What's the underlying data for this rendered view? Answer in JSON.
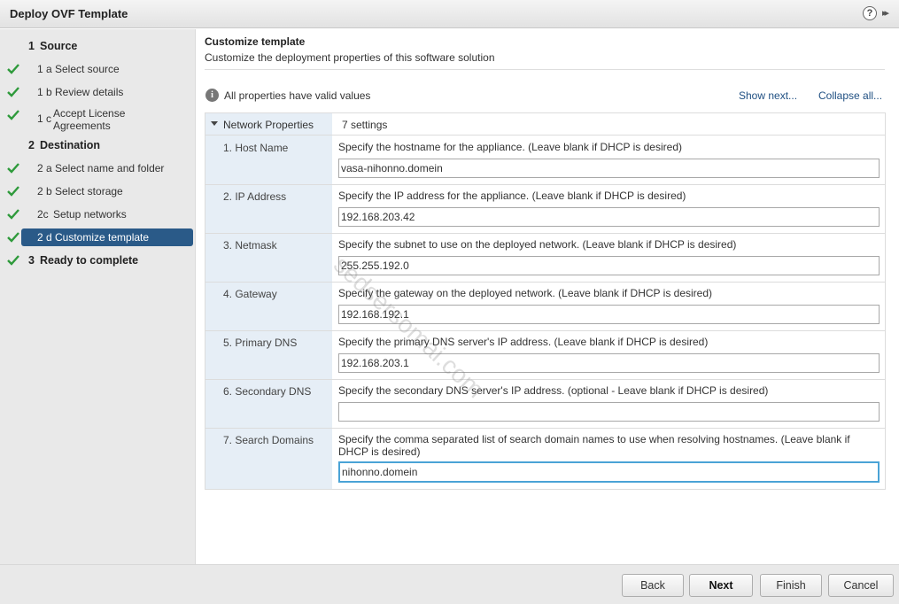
{
  "window": {
    "title": "Deploy OVF Template",
    "help_icon": "?",
    "expand_icon": "▸▸"
  },
  "sidebar": {
    "steps": [
      {
        "num": "1",
        "label": "Source",
        "type": "head",
        "checked": false
      },
      {
        "num": "1 a",
        "label": "Select source",
        "type": "sub",
        "checked": true
      },
      {
        "num": "1 b",
        "label": "Review details",
        "type": "sub",
        "checked": true
      },
      {
        "num": "1 c",
        "label": "Accept License Agreements",
        "type": "sub",
        "checked": true
      },
      {
        "num": "2",
        "label": "Destination",
        "type": "head",
        "checked": false
      },
      {
        "num": "2 a",
        "label": "Select name and folder",
        "type": "sub",
        "checked": true
      },
      {
        "num": "2 b",
        "label": "Select storage",
        "type": "sub",
        "checked": true
      },
      {
        "num": "2c",
        "label": "Setup networks",
        "type": "sub",
        "checked": true
      },
      {
        "num": "2 d",
        "label": "Customize template",
        "type": "sub",
        "checked": true,
        "active": true
      },
      {
        "num": "3",
        "label": "Ready to complete",
        "type": "head",
        "checked": true
      }
    ]
  },
  "main": {
    "title": "Customize template",
    "subtitle": "Customize the deployment properties of this software solution",
    "info_text": "All properties have valid values",
    "show_next": "Show next...",
    "collapse_all": "Collapse all...",
    "group": {
      "name": "Network Properties",
      "count": "7 settings"
    },
    "properties": [
      {
        "label": "1. Host Name",
        "desc": "Specify the hostname for the appliance. (Leave blank if DHCP is desired)",
        "value": "vasa-nihonno.domein"
      },
      {
        "label": "2. IP Address",
        "desc": "Specify the IP address for the appliance. (Leave blank if DHCP is desired)",
        "value": "192.168.203.42"
      },
      {
        "label": "3. Netmask",
        "desc": "Specify the subnet to use on the deployed network. (Leave blank if DHCP is desired)",
        "value": "255.255.192.0"
      },
      {
        "label": "4. Gateway",
        "desc": "Specify the gateway on the deployed network. (Leave blank if DHCP is desired)",
        "value": "192.168.192.1"
      },
      {
        "label": "5. Primary DNS",
        "desc": "Specify the primary DNS server's IP address. (Leave blank if DHCP is desired)",
        "value": "192.168.203.1"
      },
      {
        "label": "6. Secondary DNS",
        "desc": "Specify the secondary DNS server's IP address. (optional - Leave blank if DHCP is desired)",
        "value": ""
      },
      {
        "label": "7. Search Domains",
        "desc": "Specify the comma separated list of search domain names to use when resolving hostnames. (Leave blank if DHCP is desired)",
        "value": "nihonno.domein"
      }
    ]
  },
  "footer": {
    "back": "Back",
    "next": "Next",
    "finish": "Finish",
    "cancel": "Cancel"
  },
  "watermark": "sedsersomai.com",
  "colors": {
    "check": "#2e9a3b",
    "active_step": "#2a5a88",
    "link": "#1f4f82",
    "focus_border": "#4aa3d6"
  }
}
